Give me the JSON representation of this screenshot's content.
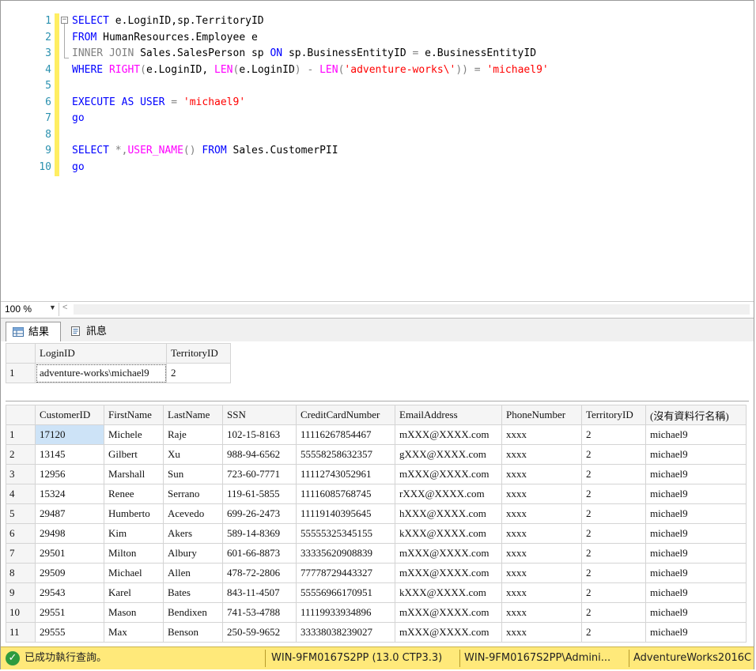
{
  "editor": {
    "line_numbers": [
      "1",
      "2",
      "3",
      "4",
      "5",
      "6",
      "7",
      "8",
      "9",
      "10"
    ],
    "lines": [
      [
        {
          "t": "SELECT ",
          "c": "kw"
        },
        {
          "t": "e.LoginID,sp.TerritoryID",
          "c": "tx"
        }
      ],
      [
        {
          "t": "FROM ",
          "c": "kw"
        },
        {
          "t": "HumanResources.Employee e",
          "c": "tx"
        }
      ],
      [
        {
          "t": "INNER JOIN ",
          "c": "gr"
        },
        {
          "t": "Sales.SalesPerson sp ",
          "c": "tx"
        },
        {
          "t": "ON ",
          "c": "kw"
        },
        {
          "t": "sp.BusinessEntityID ",
          "c": "tx"
        },
        {
          "t": "= ",
          "c": "gr"
        },
        {
          "t": "e.BusinessEntityID",
          "c": "tx"
        }
      ],
      [
        {
          "t": "WHERE ",
          "c": "kw"
        },
        {
          "t": "RIGHT",
          "c": "fn"
        },
        {
          "t": "(",
          "c": "gr"
        },
        {
          "t": "e.LoginID, ",
          "c": "tx"
        },
        {
          "t": "LEN",
          "c": "fn"
        },
        {
          "t": "(",
          "c": "gr"
        },
        {
          "t": "e.LoginID",
          "c": "tx"
        },
        {
          "t": ") - ",
          "c": "gr"
        },
        {
          "t": "LEN",
          "c": "fn"
        },
        {
          "t": "(",
          "c": "gr"
        },
        {
          "t": "'adventure-works\\'",
          "c": "str"
        },
        {
          "t": ")) = ",
          "c": "gr"
        },
        {
          "t": "'michael9'",
          "c": "str"
        }
      ],
      [],
      [
        {
          "t": "EXECUTE AS USER ",
          "c": "kw"
        },
        {
          "t": "= ",
          "c": "gr"
        },
        {
          "t": "'michael9'",
          "c": "str"
        }
      ],
      [
        {
          "t": "go",
          "c": "kw"
        }
      ],
      [],
      [
        {
          "t": "SELECT ",
          "c": "kw"
        },
        {
          "t": "*,",
          "c": "gr"
        },
        {
          "t": "USER_NAME",
          "c": "fn"
        },
        {
          "t": "() ",
          "c": "gr"
        },
        {
          "t": "FROM ",
          "c": "kw"
        },
        {
          "t": "Sales.CustomerPII",
          "c": "tx"
        }
      ],
      [
        {
          "t": "go",
          "c": "kw"
        }
      ]
    ]
  },
  "zoom": {
    "value": "100 %"
  },
  "tabs": [
    {
      "label": "結果",
      "icon": "grid-icon"
    },
    {
      "label": "訊息",
      "icon": "messages-icon"
    }
  ],
  "result1": {
    "columns": [
      "LoginID",
      "TerritoryID"
    ],
    "rows": [
      [
        "1",
        "adventure-works\\michael9",
        "2"
      ]
    ]
  },
  "result2": {
    "columns": [
      "CustomerID",
      "FirstName",
      "LastName",
      "SSN",
      "CreditCardNumber",
      "EmailAddress",
      "PhoneNumber",
      "TerritoryID",
      "(沒有資料行名稱)"
    ],
    "rows": [
      [
        "1",
        "17120",
        "Michele",
        "Raje",
        "102-15-8163",
        "11116267854467",
        "mXXX@XXXX.com",
        "xxxx",
        "2",
        "michael9"
      ],
      [
        "2",
        "13145",
        "Gilbert",
        "Xu",
        "988-94-6562",
        "55558258632357",
        "gXXX@XXXX.com",
        "xxxx",
        "2",
        "michael9"
      ],
      [
        "3",
        "12956",
        "Marshall",
        "Sun",
        "723-60-7771",
        "11112743052961",
        "mXXX@XXXX.com",
        "xxxx",
        "2",
        "michael9"
      ],
      [
        "4",
        "15324",
        "Renee",
        "Serrano",
        "119-61-5855",
        "11116085768745",
        "rXXX@XXXX.com",
        "xxxx",
        "2",
        "michael9"
      ],
      [
        "5",
        "29487",
        "Humberto",
        "Acevedo",
        "699-26-2473",
        "11119140395645",
        "hXXX@XXXX.com",
        "xxxx",
        "2",
        "michael9"
      ],
      [
        "6",
        "29498",
        "Kim",
        "Akers",
        "589-14-8369",
        "55555325345155",
        "kXXX@XXXX.com",
        "xxxx",
        "2",
        "michael9"
      ],
      [
        "7",
        "29501",
        "Milton",
        "Albury",
        "601-66-8873",
        "33335620908839",
        "mXXX@XXXX.com",
        "xxxx",
        "2",
        "michael9"
      ],
      [
        "8",
        "29509",
        "Michael",
        "Allen",
        "478-72-2806",
        "77778729443327",
        "mXXX@XXXX.com",
        "xxxx",
        "2",
        "michael9"
      ],
      [
        "9",
        "29543",
        "Karel",
        "Bates",
        "843-11-4507",
        "55556966170951",
        "kXXX@XXXX.com",
        "xxxx",
        "2",
        "michael9"
      ],
      [
        "10",
        "29551",
        "Mason",
        "Bendixen",
        "741-53-4788",
        "11119933934896",
        "mXXX@XXXX.com",
        "xxxx",
        "2",
        "michael9"
      ],
      [
        "11",
        "29555",
        "Max",
        "Benson",
        "250-59-9652",
        "33338038239027",
        "mXXX@XXXX.com",
        "xxxx",
        "2",
        "michael9"
      ]
    ]
  },
  "status": {
    "message": "已成功執行查詢。",
    "server": "WIN-9FM0167S2PP (13.0 CTP3.3)",
    "user": "WIN-9FM0167S2PP\\Admini...",
    "database": "AdventureWorks2016C"
  },
  "colors": {
    "status_bg": "#ffe97a",
    "keyword": "#0000ff",
    "function": "#ff00ff",
    "string": "#ff0000"
  }
}
